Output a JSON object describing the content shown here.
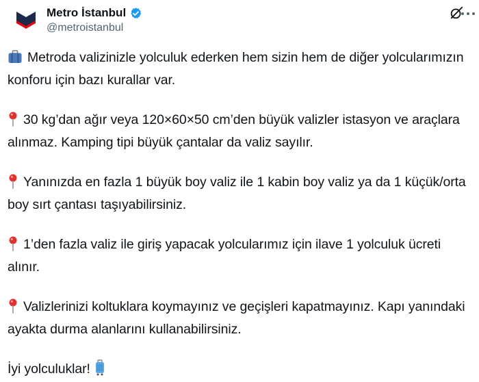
{
  "account": {
    "name": "Metro İstanbul",
    "handle": "@metroistanbul",
    "verified": true
  },
  "icons": {
    "avatar": "metro-istanbul-logo",
    "verified": "verified-badge-icon",
    "grok": "grok-icon",
    "more": "more-options-icon",
    "luggage": "luggage-emoji",
    "pin": "round-pushpin-emoji"
  },
  "colors": {
    "text": "#0f1419",
    "secondary": "#536471",
    "verified": "#1d9bf0",
    "brand_red": "#e30613",
    "brand_navy": "#1b2a4a"
  },
  "tweet": {
    "intro": "Metroda valizinizle yolculuk ederken hem sizin hem de diğer yolcularımızın konforu için bazı kurallar var.",
    "rule_1": "30 kg’dan ağır veya 120×60×50 cm’den büyük valizler istasyon ve araçlara alınmaz. Kamping tipi büyük çantalar da valiz sayılır.",
    "rule_2": "Yanınızda en fazla 1 büyük boy valiz ile 1 kabin boy valiz ya da 1 küçük/orta boy sırt çantası taşıyabilirsiniz.",
    "rule_3": "1’den fazla valiz ile giriş yapacak yolcularımız için ilave 1 yolculuk ücreti alınır.",
    "rule_4": "Valizlerinizi koltuklara koymayınız ve geçişleri kapatmayınız. Kapı yanındaki ayakta durma alanlarını kullanabilirsiniz.",
    "closing": "İyi yolculuklar!"
  }
}
